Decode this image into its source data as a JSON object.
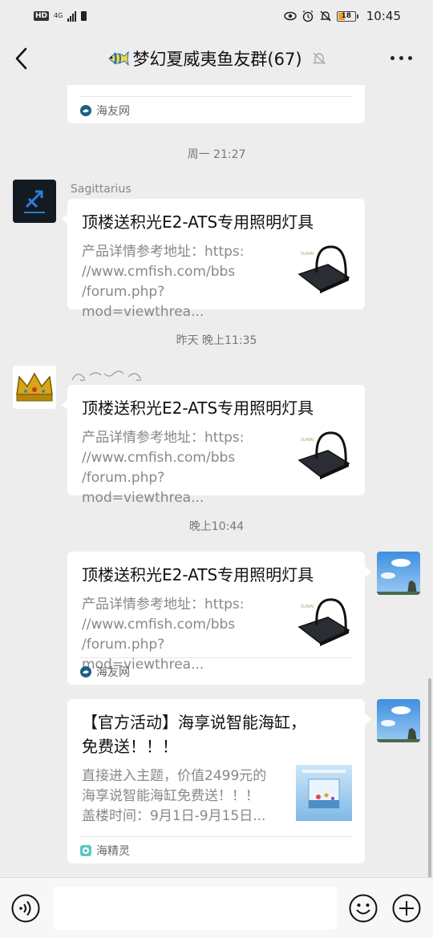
{
  "status_bar": {
    "hd": "HD",
    "network": "4G",
    "battery": "18",
    "time": "10:45"
  },
  "header": {
    "title": "梦幻夏威夷鱼友群(67)",
    "back_icon": "chevron-left-icon",
    "mute_icon": "bell-off-icon",
    "more_icon": "more-dots-icon"
  },
  "messages": [
    {
      "type": "card-tail",
      "source": "海友网"
    },
    {
      "type": "time",
      "text": "周一 21:27"
    },
    {
      "type": "card",
      "sender": "Sagittarius",
      "title": "顶楼送积光E2-ATS专用照明灯具",
      "desc": [
        "产品详情参考地址：https:",
        "//www.cmfish.com/bbs",
        "/forum.php?mod=viewthrea..."
      ]
    },
    {
      "type": "time",
      "text": "昨天 晚上11:35"
    },
    {
      "type": "card",
      "title": "顶楼送积光E2-ATS专用照明灯具",
      "desc": [
        "产品详情参考地址：https:",
        "//www.cmfish.com/bbs",
        "/forum.php?mod=viewthrea..."
      ]
    },
    {
      "type": "time",
      "text": "晚上10:44"
    },
    {
      "type": "card",
      "title": "顶楼送积光E2-ATS专用照明灯具",
      "desc": [
        "产品详情参考地址：https:",
        "//www.cmfish.com/bbs",
        "/forum.php?mod=viewthrea..."
      ],
      "source": "海友网"
    },
    {
      "type": "card",
      "title": "【官方活动】海享说智能海缸，免费送！！！",
      "title_lines": [
        "【官方活动】海享说智能海缸，",
        "免费送！！！"
      ],
      "desc": [
        "直接进入主题，价值2499元的",
        "海享说智能海缸免费送！！！",
        "盖楼时间：9月1日-9月15日..."
      ],
      "source": "海精灵"
    }
  ],
  "input_bar": {
    "voice_icon": "voice-icon",
    "emoji_icon": "emoji-icon",
    "plus_icon": "plus-icon"
  }
}
